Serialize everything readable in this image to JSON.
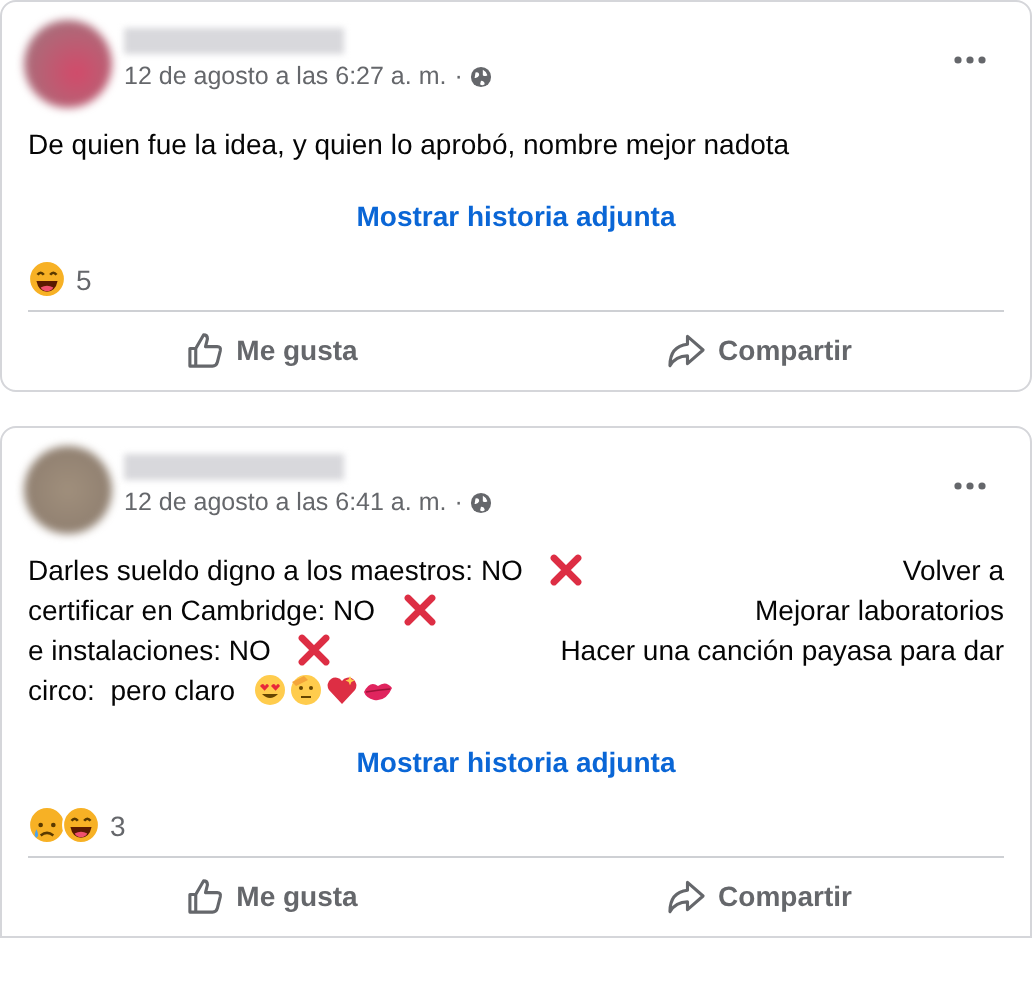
{
  "posts": [
    {
      "timestamp": "12 de agosto a las 6:27 a. m.",
      "separator": "·",
      "lines": [
        {
          "left": [
            {
              "kind": "text",
              "text": "De quien fue la idea, y quien lo aprobó, nombre mejor nadota"
            }
          ]
        }
      ],
      "link": "Mostrar historia adjunta",
      "reactions": [
        {
          "kind": "laugh"
        }
      ],
      "reaction_count": "5",
      "actions": [
        {
          "kind": "like",
          "label": "Me gusta"
        },
        {
          "kind": "share",
          "label": "Compartir"
        }
      ]
    },
    {
      "timestamp": "12 de agosto a las 6:41 a. m.",
      "separator": "·",
      "lines": [
        {
          "left": [
            {
              "kind": "text",
              "text": "Darles sueldo digno a los maestros: NO"
            },
            {
              "kind": "cross"
            }
          ],
          "right": "Volver a"
        },
        {
          "left": [
            {
              "kind": "text",
              "text": "certificar en Cambridge: NO"
            },
            {
              "kind": "cross"
            }
          ],
          "right": "Mejorar laboratorios"
        },
        {
          "left": [
            {
              "kind": "text",
              "text": "e instalaciones: NO"
            },
            {
              "kind": "cross"
            }
          ],
          "right": "Hacer una canción payasa para dar"
        },
        {
          "left": [
            {
              "kind": "text",
              "text": "circo:  pero claro"
            },
            {
              "kind": "hearteyes"
            },
            {
              "kind": "salute"
            },
            {
              "kind": "heart"
            },
            {
              "kind": "kiss"
            }
          ]
        }
      ],
      "link": "Mostrar historia adjunta",
      "reactions": [
        {
          "kind": "sad"
        },
        {
          "kind": "laugh"
        }
      ],
      "reaction_count": "3",
      "actions": [
        {
          "kind": "like",
          "label": "Me gusta"
        },
        {
          "kind": "share",
          "label": "Compartir"
        }
      ]
    }
  ]
}
